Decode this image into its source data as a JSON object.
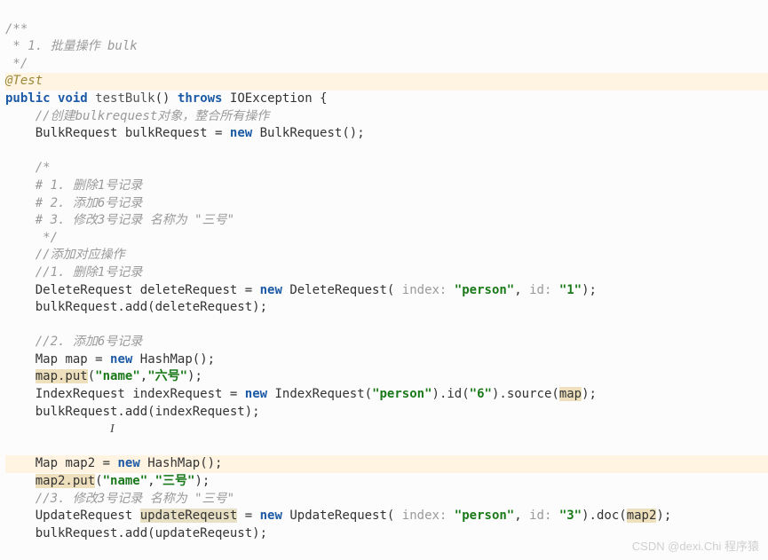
{
  "doc": {
    "c0": "/**",
    "c1": " * 1. 批量操作 bulk",
    "c2": " */",
    "ann": "@Test",
    "kw_public": "public",
    "kw_void": "void",
    "fn_testBulk": "testBulk",
    "kw_throws": "throws",
    "ty_IOException": "IOException",
    "lbrace": "{",
    "c3": "//创建bulkrequest对象，整合所有操作",
    "ty_BulkRequest": "BulkRequest",
    "id_bulkRequest": "bulkRequest",
    "eq": " = ",
    "kw_new": "new",
    "call_BulkRequest": "BulkRequest();",
    "c4a": "/*",
    "c4b": "# 1. 删除1号记录",
    "c4c": "# 2. 添加6号记录",
    "c4d": "# 3. 修改3号记录 名称为 \"三号\"",
    "c4e": " */",
    "c5": "//添加对应操作",
    "c6": "//1. 删除1号记录",
    "ty_DeleteRequest": "DeleteRequest",
    "id_deleteRequest": "deleteRequest",
    "call_DeleteRequest_open": "DeleteRequest( ",
    "hint_index": "index: ",
    "str_person": "\"person\"",
    "comma_sp": ", ",
    "hint_id": "id: ",
    "str_1": "\"1\"",
    "close_call": ");",
    "stmt_bulk_add_delete": "bulkRequest.add(deleteRequest);",
    "c7": "//2. 添加6号记录",
    "ty_Map": "Map",
    "id_map": "map",
    "call_HashMap": "HashMap();",
    "id_map_put_open": "map.put",
    "lp": "(",
    "str_name": "\"name\"",
    "comma": ",",
    "str_six": "\"六号\"",
    "rp_semi": ");",
    "ty_IndexRequest": "IndexRequest",
    "id_indexRequest": "indexRequest",
    "call_IndexRequest_open": "IndexRequest(",
    "chain_id6": ").id(",
    "str_6": "\"6\"",
    "chain_source": ").source(",
    "id_map_arg": "map",
    "stmt_bulk_add_index": "bulkRequest.add(indexRequest);",
    "id_map2": "map2",
    "call_HashMap2": "HashMap();",
    "id_map2_put_open": "map2.put",
    "str_three": "\"三号\"",
    "c8": "//3. 修改3号记录 名称为 \"三号\"",
    "ty_UpdateRequest": "UpdateRequest",
    "id_updateReqeust": "updateReqeust",
    "call_UpdateRequest_open": "UpdateRequest( ",
    "str_3": "\"3\"",
    "chain_doc": ").doc(",
    "id_map2_arg": "map2",
    "stmt_bulk_add_update": "bulkRequest.add(updateReqeust);",
    "ibeam": "I"
  },
  "watermark": "CSDN @dexi.Chi 程序猿"
}
